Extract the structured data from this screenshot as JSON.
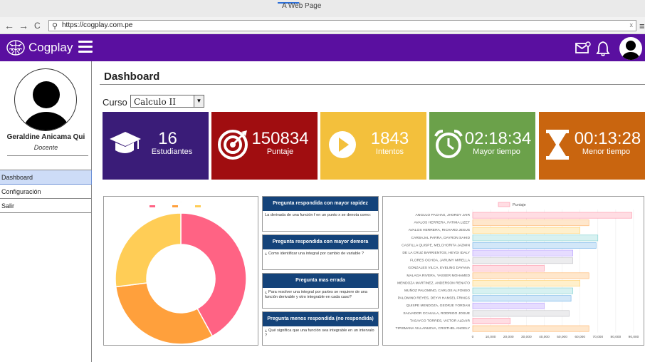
{
  "browser": {
    "tab_title": "A Web Page",
    "url": "https://cogplay.com.pe",
    "back": "←",
    "forward": "→",
    "reload": "C",
    "menu": "≡",
    "clear": "x"
  },
  "app": {
    "brand": "Cogplay",
    "colors": {
      "appbar": "#5a0fa0"
    }
  },
  "sidebar": {
    "user_name": "Geraldine Anicama Qui",
    "user_role": "Docente",
    "items": [
      {
        "label": "Dashboard",
        "active": true
      },
      {
        "label": "Configuración",
        "active": false
      },
      {
        "label": "Salir",
        "active": false
      }
    ]
  },
  "main": {
    "title": "Dashboard",
    "course_label": "Curso",
    "course_value": "Calculo II"
  },
  "cards": [
    {
      "value": "16",
      "label": "Estudiantes",
      "color": "#3a1c78",
      "icon": "graduation-cap-icon"
    },
    {
      "value": "150834",
      "label": "Puntaje",
      "color": "#a00d10",
      "icon": "target-icon"
    },
    {
      "value": "1843",
      "label": "Intentos",
      "color": "#f3c03c",
      "icon": "play-icon"
    },
    {
      "value": "02:18:34",
      "label": "Mayor tiempo",
      "color": "#6ba14a",
      "icon": "alarm-clock-icon"
    },
    {
      "value": "00:13:28",
      "label": "Menor tiempo",
      "color": "#c9650f",
      "icon": "hourglass-icon"
    }
  ],
  "questions": [
    {
      "title": "Pregunta respondida con mayor rapidez",
      "text": "La derivada de una función f en un punto x se denota como:"
    },
    {
      "title": "Pregunta respondida con mayor demora",
      "text": "¿ Como identificar una integral por cambio de variable ?"
    },
    {
      "title": "Pregunta mas errada",
      "text": "¿ Para resolver una integral por partes se requiere de una función derivable y otro integrable en cada caso?"
    },
    {
      "title": "Pregunta menos respondida (no respondida)",
      "text": "¿ Qué significa que una función sea integrable en un intervalo ?"
    }
  ],
  "chart_data": [
    {
      "type": "pie",
      "title": "",
      "slices": [
        {
          "value": 42,
          "color": "#ff6384"
        },
        {
          "value": 31,
          "color": "#ffa03c"
        },
        {
          "value": 27,
          "color": "#ffcd56"
        }
      ]
    },
    {
      "type": "bar",
      "orientation": "horizontal",
      "legend": "Puntaje",
      "xlim": [
        0,
        90000
      ],
      "xticks": [
        "0",
        "10,000",
        "20,000",
        "30,000",
        "40,000",
        "50,000",
        "60,000",
        "70,000",
        "80,000",
        "90,000"
      ],
      "categories": [
        "ANGULO PACHAS, JHORDY JAIR",
        "AVALOS HERRERA, FATIMA LIZET",
        "AVALOS HERRERA, RICHARD JESUS",
        "CARBAJAL PARRA, DAYRON SAHID",
        "CASTILLA QUISPE, MELCHORITA JAZMIN",
        "DE LA CRUZ BARRIENTOS, HEYDI IDALY",
        "FLORES OCHOA, JARUMY MIRELLA",
        "GONZALES VILCA, EVELING DAYANA",
        "MALAGA RIVERA, YASSER MOHAMED",
        "MENDOZA MARTINEZ, ANDERSON RENATO",
        "MUÑOZ PALOMINO, CARLOS ALFONSO",
        "PALOMINO REYES, DEYVI HANSEL FRINGS",
        "QUISPE MENDOZA, GEORJE YORDAN",
        "SALVADOR CCAULLA, RODRIGO JOSUE",
        "TASAYCO TORRES, VICTOR ALDAIR",
        "TIPISMANA VILLANUEVA, CRISTHEL ANGELY"
      ],
      "values": [
        89000,
        65000,
        60000,
        70000,
        69000,
        56000,
        56000,
        40000,
        65000,
        60000,
        56000,
        55000,
        40000,
        54000,
        21000,
        65000
      ],
      "colors": [
        "#ffdde3",
        "#ffe7cc",
        "#fff0cc",
        "#d7f1f1",
        "#d2e7f8",
        "#e6dcff",
        "#ececee",
        "#ffdde3",
        "#ffe7cc",
        "#fff0cc",
        "#d7f1f1",
        "#d2e7f8",
        "#e6dcff",
        "#ececee",
        "#ffdde3",
        "#ffe7cc"
      ],
      "borders": [
        "#ff8fa5",
        "#ffb266",
        "#ffd06b",
        "#7ccfcf",
        "#6fb2e8",
        "#b49cff",
        "#c0c0c6",
        "#ff8fa5",
        "#ffb266",
        "#ffd06b",
        "#7ccfcf",
        "#6fb2e8",
        "#b49cff",
        "#c0c0c6",
        "#ff8fa5",
        "#ffb266"
      ]
    }
  ]
}
